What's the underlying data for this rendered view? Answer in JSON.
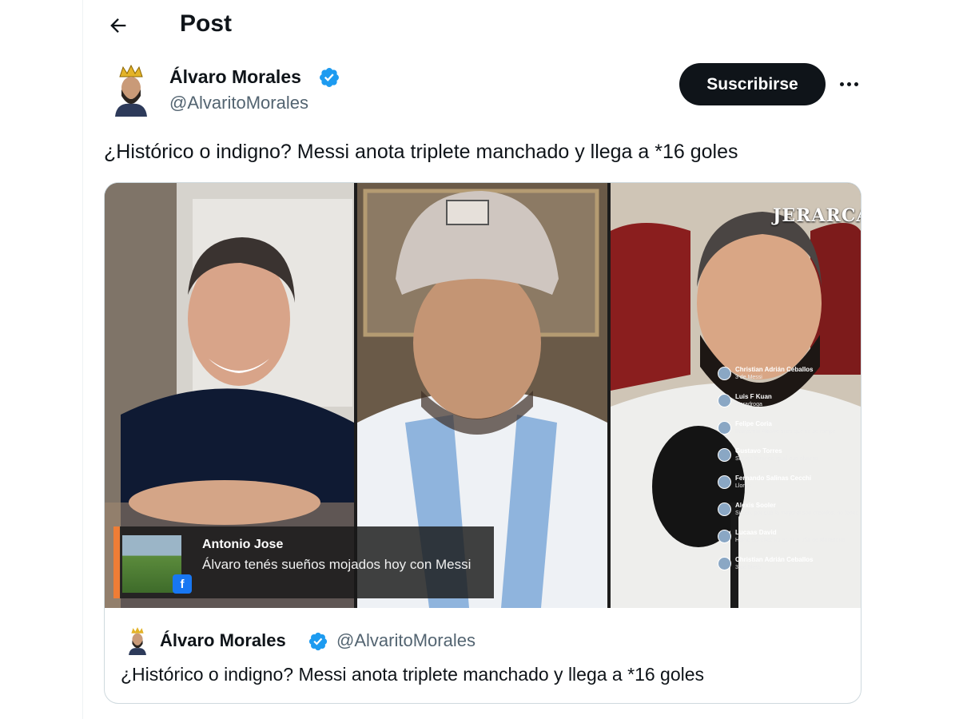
{
  "header": {
    "back_icon": "arrow-left-icon",
    "title": "Post"
  },
  "author": {
    "name": "Álvaro Morales",
    "handle": "@AlvaritoMorales",
    "verified": true,
    "subscribe_label": "Suscribirse",
    "more_icon": "more-horizontal-icon"
  },
  "tweet": {
    "text": "¿Histórico o indigno? Messi anota triplete manchado y llega a *16 goles"
  },
  "media": {
    "brand": "JERARCAS",
    "facebook_comment": {
      "name": "Antonio Jose",
      "message": "Álvaro tenés sueños mojados hoy con Messi",
      "platform_icon": "facebook-icon"
    },
    "live_comments": [
      {
        "name": "Christian Adrián Ceballos",
        "text": "3 de Messi"
      },
      {
        "name": "Luis F Kuan",
        "text": "Maradroga"
      },
      {
        "name": "Felipe Coria",
        "text": "Benyamín Alastre si es que no se rompe"
      },
      {
        "name": "Gustavo Torres",
        "text": "Siguen llorando igual que alvarito"
      },
      {
        "name": "Fernando Salinas Cecchi",
        "text": "Lloron"
      },
      {
        "name": "Alexis Sooler",
        "text": "Si Leo, por qué la mayoría son crecidos, no todos"
      },
      {
        "name": "Lucaas David",
        "text": "Hamo sanchez no es ni la uña de Maradona"
      },
      {
        "name": "Christian Adrián Ceballos",
        "text": "3 de Messi"
      }
    ]
  },
  "quoted": {
    "name": "Álvaro Morales",
    "handle": "@AlvaritoMorales",
    "text": "¿Histórico o indigno? Messi anota triplete manchado y llega a *16 goles"
  },
  "colors": {
    "verified": "#1d9bf0",
    "button_bg": "#0f1419",
    "muted_text": "#536471",
    "border": "#cfd9de"
  }
}
